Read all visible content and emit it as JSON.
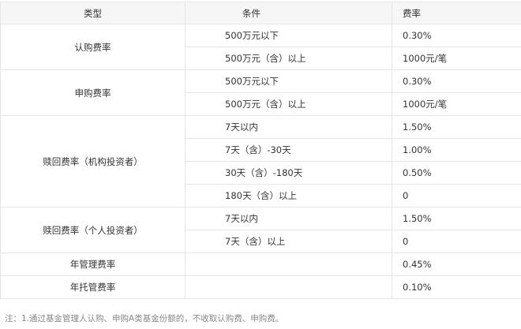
{
  "table": {
    "headers": [
      "类型",
      "条件",
      "费率"
    ],
    "rows": [
      {
        "type": "认购费率",
        "cond": "500万元以下",
        "rate": "0.30%"
      },
      {
        "cond": "500万元（含）以上",
        "rate": "1000元/笔"
      },
      {
        "type": "申购费率",
        "cond": "500万元以下",
        "rate": "0.30%"
      },
      {
        "cond": "500万元（含）以上",
        "rate": "1000元/笔"
      },
      {
        "type": "赎回费率（机构投资者）",
        "cond": "7天以内",
        "rate": "1.50%"
      },
      {
        "cond": "7天（含）-30天",
        "rate": "1.00%"
      },
      {
        "cond": "30天（含）-180天",
        "rate": "0.50%"
      },
      {
        "cond": "180天（含）以上",
        "rate": "0"
      },
      {
        "type": "赎回费率（个人投资者）",
        "cond": "7天以内",
        "rate": "1.50%"
      },
      {
        "cond": "7天（含）以上",
        "rate": "0"
      },
      {
        "type": "年管理费率",
        "cond": "",
        "rate": "0.45%"
      },
      {
        "type": "年托管费率",
        "cond": "",
        "rate": "0.10%"
      }
    ]
  },
  "note": "注：1.通过基金管理人认购、申购A类基金份额的，不收取认购费、申购费。"
}
